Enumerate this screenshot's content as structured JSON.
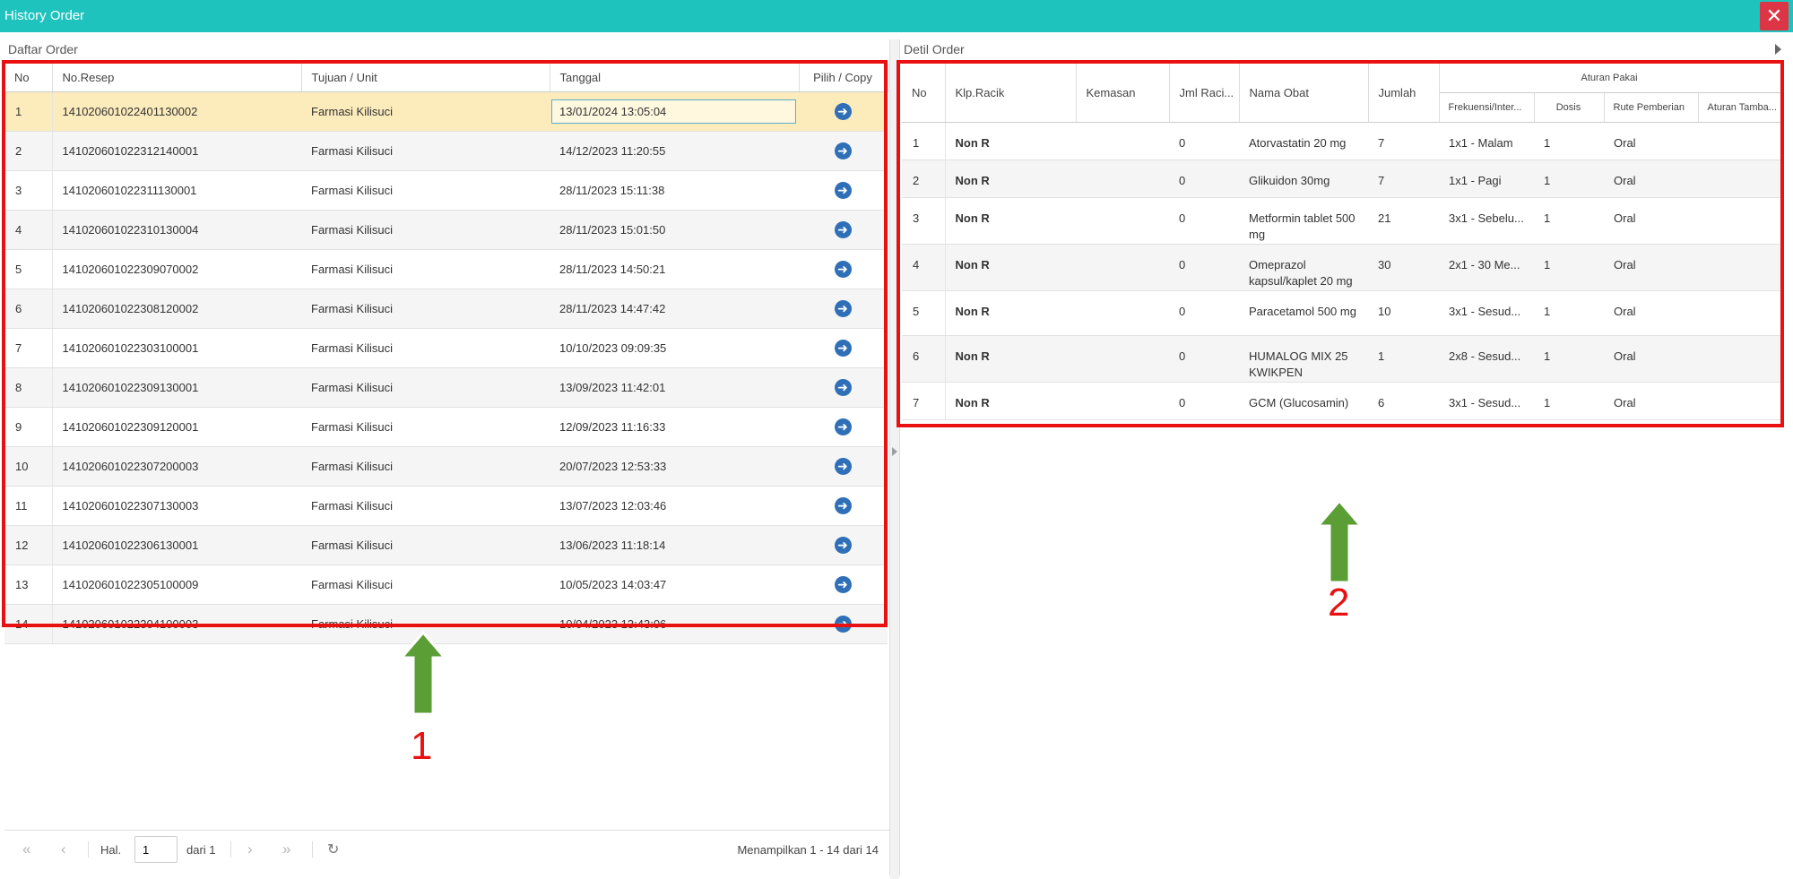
{
  "window": {
    "title": "History Order",
    "close_icon": "close-icon"
  },
  "left_panel": {
    "title": "Daftar Order",
    "columns": [
      "No",
      "No.Resep",
      "Tujuan / Unit",
      "Tanggal",
      "Pilih / Copy"
    ],
    "rows": [
      {
        "no": "1",
        "resep": "141020601022401130002",
        "unit": "Farmasi Kilisuci",
        "tanggal": "13/01/2024 13:05:04"
      },
      {
        "no": "2",
        "resep": "141020601022312140001",
        "unit": "Farmasi Kilisuci",
        "tanggal": "14/12/2023 11:20:55"
      },
      {
        "no": "3",
        "resep": "141020601022311130001",
        "unit": "Farmasi Kilisuci",
        "tanggal": "28/11/2023 15:11:38"
      },
      {
        "no": "4",
        "resep": "141020601022310130004",
        "unit": "Farmasi Kilisuci",
        "tanggal": "28/11/2023 15:01:50"
      },
      {
        "no": "5",
        "resep": "141020601022309070002",
        "unit": "Farmasi Kilisuci",
        "tanggal": "28/11/2023 14:50:21"
      },
      {
        "no": "6",
        "resep": "141020601022308120002",
        "unit": "Farmasi Kilisuci",
        "tanggal": "28/11/2023 14:47:42"
      },
      {
        "no": "7",
        "resep": "141020601022303100001",
        "unit": "Farmasi Kilisuci",
        "tanggal": "10/10/2023 09:09:35"
      },
      {
        "no": "8",
        "resep": "141020601022309130001",
        "unit": "Farmasi Kilisuci",
        "tanggal": "13/09/2023 11:42:01"
      },
      {
        "no": "9",
        "resep": "141020601022309120001",
        "unit": "Farmasi Kilisuci",
        "tanggal": "12/09/2023 11:16:33"
      },
      {
        "no": "10",
        "resep": "141020601022307200003",
        "unit": "Farmasi Kilisuci",
        "tanggal": "20/07/2023 12:53:33"
      },
      {
        "no": "11",
        "resep": "141020601022307130003",
        "unit": "Farmasi Kilisuci",
        "tanggal": "13/07/2023 12:03:46"
      },
      {
        "no": "12",
        "resep": "141020601022306130001",
        "unit": "Farmasi Kilisuci",
        "tanggal": "13/06/2023 11:18:14"
      },
      {
        "no": "13",
        "resep": "141020601022305100009",
        "unit": "Farmasi Kilisuci",
        "tanggal": "10/05/2023 14:03:47"
      },
      {
        "no": "14",
        "resep": "141020601022304100003",
        "unit": "Farmasi Kilisuci",
        "tanggal": "10/04/2023 13:43:06"
      }
    ],
    "action_icon": "arrow-right-circle-icon"
  },
  "right_panel": {
    "title": "Detil Order",
    "columns": {
      "no": "No",
      "klp": "Klp.Racik",
      "kemasan": "Kemasan",
      "jml": "Jml Raci...",
      "nama": "Nama Obat",
      "jumlah": "Jumlah",
      "group": "Aturan Pakai",
      "frek": "Frekuensi/Inter...",
      "dosis": "Dosis",
      "rute": "Rute Pemberian",
      "tambahan": "Aturan Tamba..."
    },
    "rows": [
      {
        "no": "1",
        "klp": "Non R",
        "kemasan": "",
        "jml": "0",
        "nama": "Atorvastatin 20 mg",
        "jumlah": "7",
        "frek": "1x1 - Malam",
        "dosis": "1",
        "rute": "Oral",
        "tambahan": ""
      },
      {
        "no": "2",
        "klp": "Non R",
        "kemasan": "",
        "jml": "0",
        "nama": "Glikuidon 30mg",
        "jumlah": "7",
        "frek": "1x1 - Pagi",
        "dosis": "1",
        "rute": "Oral",
        "tambahan": ""
      },
      {
        "no": "3",
        "klp": "Non R",
        "kemasan": "",
        "jml": "0",
        "nama": "Metformin tablet 500 mg",
        "jumlah": "21",
        "frek": "3x1 - Sebelu...",
        "dosis": "1",
        "rute": "Oral",
        "tambahan": ""
      },
      {
        "no": "4",
        "klp": "Non R",
        "kemasan": "",
        "jml": "0",
        "nama": "Omeprazol kapsul/kaplet 20 mg",
        "jumlah": "30",
        "frek": "2x1 - 30 Me...",
        "dosis": "1",
        "rute": "Oral",
        "tambahan": ""
      },
      {
        "no": "5",
        "klp": "Non R",
        "kemasan": "",
        "jml": "0",
        "nama": "Paracetamol 500 mg",
        "jumlah": "10",
        "frek": "3x1 - Sesud...",
        "dosis": "1",
        "rute": "Oral",
        "tambahan": ""
      },
      {
        "no": "6",
        "klp": "Non R",
        "kemasan": "",
        "jml": "0",
        "nama": "HUMALOG MIX 25 KWIKPEN",
        "jumlah": "1",
        "frek": "2x8 - Sesud...",
        "dosis": "1",
        "rute": "Oral",
        "tambahan": ""
      },
      {
        "no": "7",
        "klp": "Non R",
        "kemasan": "",
        "jml": "0",
        "nama": "GCM (Glucosamin)",
        "jumlah": "6",
        "frek": "3x1 - Sesud...",
        "dosis": "1",
        "rute": "Oral",
        "tambahan": ""
      }
    ]
  },
  "pager": {
    "hal_label": "Hal.",
    "page_value": "1",
    "dari_label": "dari 1",
    "info": "Menampilkan 1 - 14 dari 14"
  },
  "annotations": {
    "label_1": "1",
    "label_2": "2",
    "box_color": "#e81010",
    "arrow_color": "#5a9e35"
  }
}
